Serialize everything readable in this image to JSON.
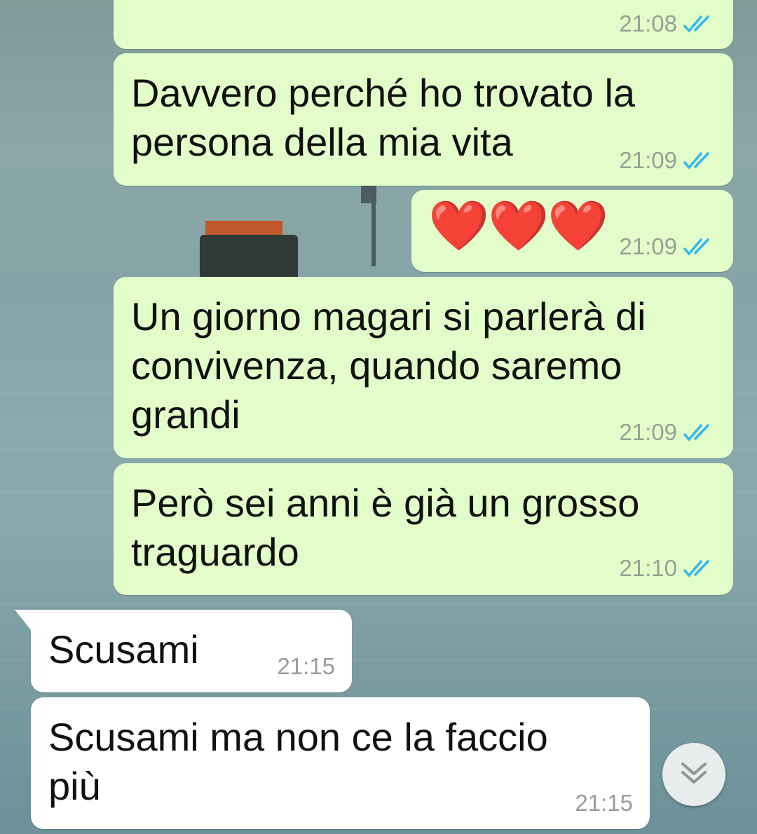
{
  "theme": {
    "outgoing_bubble": "#e2fdc9",
    "incoming_bubble": "#ffffff",
    "read_ticks": "#34b7f1"
  },
  "messages": [
    {
      "direction": "outgoing",
      "text": "",
      "time": "21:08",
      "status": "read"
    },
    {
      "direction": "outgoing",
      "text": "Davvero perché ho trovato la\npersona della mia vita",
      "time": "21:09",
      "status": "read"
    },
    {
      "direction": "outgoing",
      "text": "❤️❤️❤️",
      "time": "21:09",
      "status": "read"
    },
    {
      "direction": "outgoing",
      "text": "Un giorno magari si parlerà di\nconvivenza, quando saremo\ngrandi",
      "time": "21:09",
      "status": "read"
    },
    {
      "direction": "outgoing",
      "text": "Però sei anni è già un grosso\ntraguardo",
      "time": "21:10",
      "status": "read"
    },
    {
      "direction": "incoming",
      "text": "Scusami",
      "time": "21:15"
    },
    {
      "direction": "incoming",
      "text": "Scusami ma non ce la faccio\npiù",
      "time": "21:15"
    }
  ],
  "controls": {
    "scroll_down_icon": "double-chevron-down-icon"
  }
}
